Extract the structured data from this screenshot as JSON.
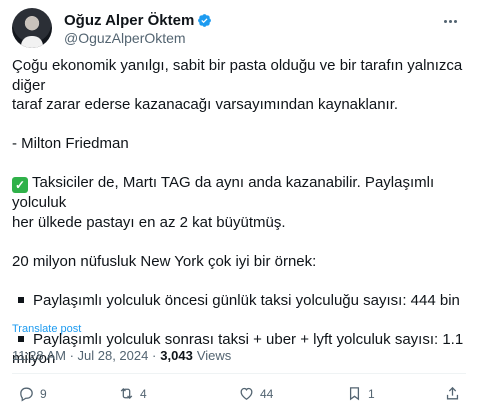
{
  "author": {
    "display_name": "Oğuz Alper Öktem",
    "handle": "@OguzAlperOktem"
  },
  "tweet": {
    "line1": "Çoğu ekonomik yanılgı, sabit bir pasta olduğu ve bir tarafın yalnızca diğer",
    "line2": "taraf zarar ederse kazanacağı varsayımından kaynaklanır.",
    "line3": "- Milton Friedman",
    "line4": "Taksiciler de, Martı TAG da aynı anda kazanabilir. Paylaşımlı yolculuk",
    "line5": "her ülkede pastayı en az 2 kat büyütmüş.",
    "line6": "20 milyon nüfusluk New York çok iyi bir örnek:",
    "bullet1": "Paylaşımlı yolculuk öncesi günlük taksi yolculuğu sayısı: 444 bin",
    "bullet2a": "Paylaşımlı yolculuk sonrası taksi + uber + lyft yolculuk sayısı: 1.1",
    "bullet2b": "milyon",
    "translate": "Translate post"
  },
  "meta": {
    "timestamp": "11:28 AM · Jul 28, 2024 ·",
    "views_count": "3,043",
    "views_label": "Views"
  },
  "actions": {
    "replies": "9",
    "reposts": "4",
    "likes": "44",
    "bookmarks": "1"
  },
  "colors": {
    "accent": "#1d9bf0",
    "text": "#0f1419",
    "secondary": "#536471",
    "check": "#2fb149"
  },
  "icons": [
    "verified-badge-icon",
    "more-icon",
    "reply-icon",
    "repost-icon",
    "like-icon",
    "bookmark-icon",
    "share-icon",
    "check-mark-icon"
  ]
}
